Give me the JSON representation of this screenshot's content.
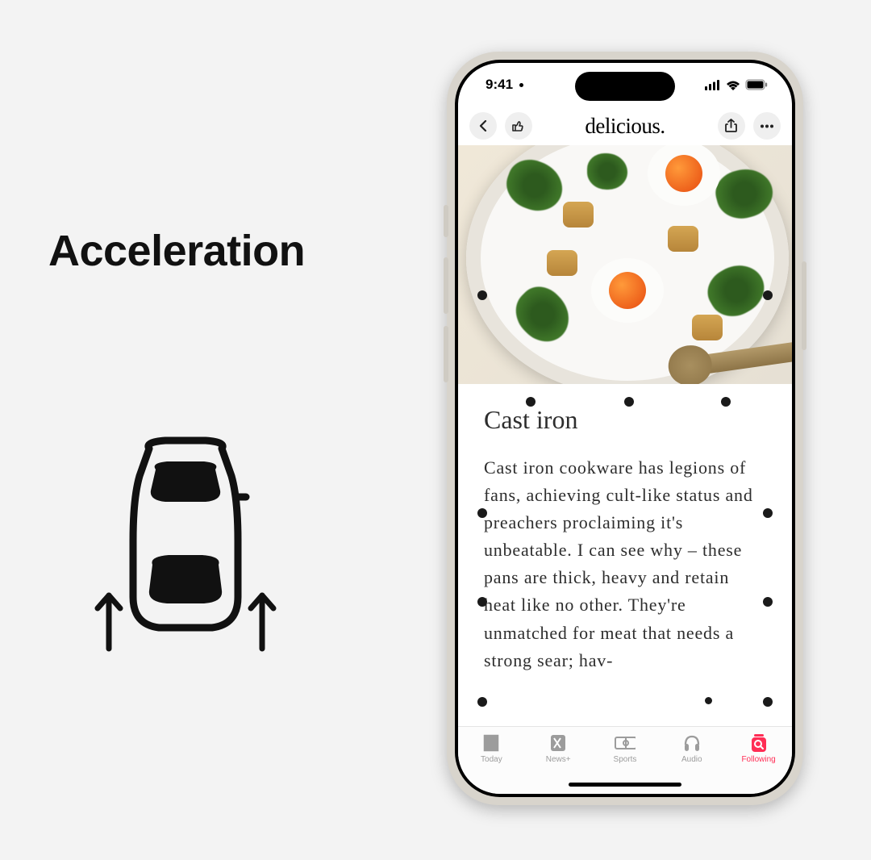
{
  "left": {
    "title": "Acceleration"
  },
  "status": {
    "time": "9:41"
  },
  "nav": {
    "title": "delicious."
  },
  "article": {
    "title": "Cast iron",
    "body": "Cast iron cookware has legions of fans, achieving cult-like status and preachers proclaiming it's unbeatable. I can see why – these pans are thick, heavy and retain heat like no other. They're unmatched for meat that needs a strong sear; hav-"
  },
  "tabs": [
    {
      "label": "Today"
    },
    {
      "label": "News+"
    },
    {
      "label": "Sports"
    },
    {
      "label": "Audio"
    },
    {
      "label": "Following"
    }
  ],
  "active_tab_index": 4
}
